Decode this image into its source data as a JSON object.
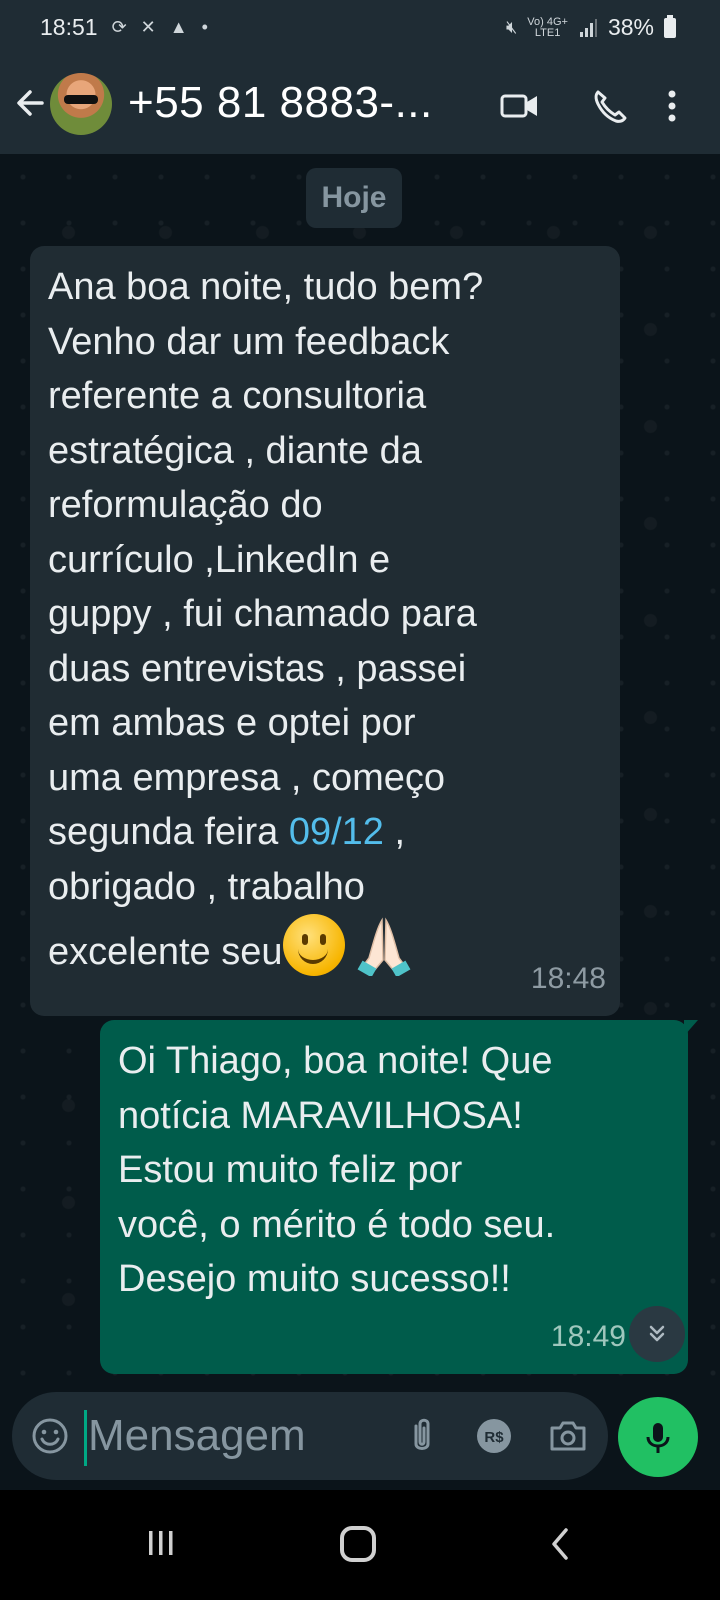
{
  "status_bar": {
    "time": "18:51",
    "battery": "38%",
    "network_top": "Vo) 4G+",
    "network_bottom": "LTE1"
  },
  "header": {
    "contact_name": "+55 81 8883-...",
    "icons": [
      "back-arrow-icon",
      "avatar",
      "video-call-icon",
      "voice-call-icon",
      "more-options-icon"
    ]
  },
  "chat": {
    "date_divider": "Hoje",
    "messages": [
      {
        "direction": "incoming",
        "lines": [
          "Ana boa noite, tudo bem?",
          "Venho dar um feedback",
          "referente a consultoria",
          "estratégica , diante da",
          "reformulação do",
          "currículo ,LinkedIn e",
          "guppy , fui chamado para",
          "duas entrevistas , passei",
          "em ambas e optei por",
          "uma empresa , começo"
        ],
        "line_date_prefix": "segunda feira ",
        "line_date_link": "09/12",
        "line_date_suffix": " ,",
        "line_thanks": "obrigado , trabalho",
        "line_last": "excelente seu",
        "emojis": [
          "smiling-face-emoji",
          "folded-hands-emoji"
        ],
        "time": "18:48"
      },
      {
        "direction": "outgoing",
        "lines": [
          "Oi Thiago, boa noite! Que",
          "notícia MARAVILHOSA!",
          "Estou muito feliz por",
          "você, o mérito é todo seu.",
          "Desejo muito sucesso!!"
        ],
        "time": "18:49"
      }
    ]
  },
  "input": {
    "placeholder": "Mensagem",
    "icons": [
      "emoji-icon",
      "attach-icon",
      "payment-icon",
      "camera-icon",
      "mic-icon"
    ],
    "accent": "#21c063"
  },
  "colors": {
    "background": "#0b141a",
    "header": "#1f2c34",
    "incoming_bubble": "#202c33",
    "outgoing_bubble": "#005c4b",
    "link": "#53bdeb"
  }
}
